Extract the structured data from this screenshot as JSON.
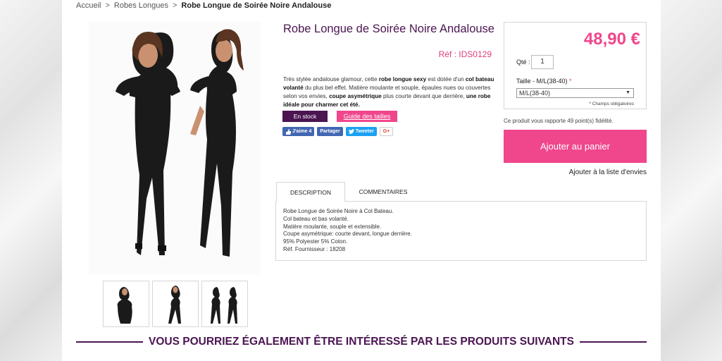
{
  "breadcrumb": {
    "home": "Accueil",
    "sep1": ">",
    "category": "Robes Longues",
    "sep2": ">",
    "current": "Robe Longue de Soirée Noire Andalouse"
  },
  "product": {
    "title": "Robe Longue de Soirée Noire Andalouse",
    "ref": "Réf : IDS0129",
    "description": {
      "p1": "Très stylée andalouse glamour, cette ",
      "b1": "robe longue sexy",
      "p2": " est dotée d'un ",
      "b2": "col bateau volanté",
      "p3": " du plus bel effet. Matière moulante et souple, épaules nues ou couvertes selon vos envies, ",
      "b3": "coupe asymétrique",
      "p4": " plus courte devant que derrière, ",
      "b4": "une robe idéale pour charmer cet été."
    },
    "stock_label": "En stock",
    "size_guide_label": "Guide des tailles",
    "social": {
      "like": "J'aime 4",
      "share": "Partager",
      "tweet": "Tweeter",
      "gplus": "G+"
    }
  },
  "buybox": {
    "price": "48,90 €",
    "qty_label": "Qté :",
    "qty_value": "1",
    "size_label": "Taille - M/L(38-40)",
    "size_required_mark": "*",
    "size_selected": "M/L(38-40)",
    "required_note": "* Champs obligatoires",
    "points_text": "Ce produit vous rapporte 49 point(s) fidélité.",
    "cart_button": "Ajouter au panier",
    "wishlist_link": "Ajouter à la liste d'envies"
  },
  "tabs": {
    "description": "DESCRIPTION",
    "comments": "COMMENTAIRES",
    "panel_lines": [
      "Robe Longue de Soirée Noire à Col Bateau.",
      "Col bateau et bas volanté.",
      "Matière moulante, souple et extensible.",
      "Coupe asymétrique: courte devant, longue derrière.",
      "95% Polyester 5% Coton.",
      "Réf. Fournisseur : 18208"
    ]
  },
  "related": {
    "heading": "VOUS POURRIEZ ÉGALEMENT ÊTRE INTÉRESSÉ PAR LES PRODUITS SUIVANTS"
  },
  "colors": {
    "accent_pink": "#f0468c",
    "brand_purple": "#4a1551"
  }
}
